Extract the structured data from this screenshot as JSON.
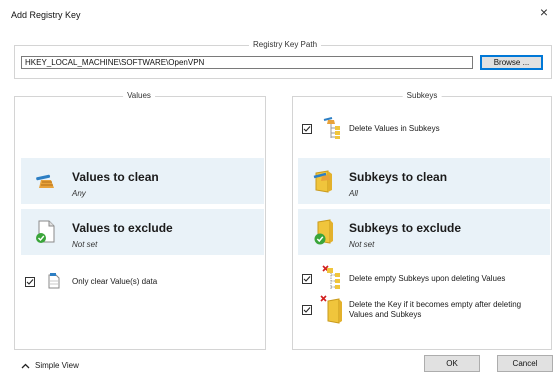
{
  "window": {
    "title": "Add Registry Key",
    "close": "×"
  },
  "path_group": {
    "label": "Registry Key Path",
    "value": "HKEY_LOCAL_MACHINE\\SOFTWARE\\OpenVPN",
    "browse_label": "Browse ..."
  },
  "values_group": {
    "label": "Values",
    "clean": {
      "title": "Values to clean",
      "subtitle": "Any",
      "icon": "broom-icon"
    },
    "exclude": {
      "title": "Values to exclude",
      "subtitle": "Not set",
      "icon": "document-check-icon"
    },
    "only_clear": {
      "label": "Only clear Value(s) data",
      "checked": true
    }
  },
  "subkeys_group": {
    "label": "Subkeys",
    "delete_values": {
      "label": "Delete Values in Subkeys",
      "checked": true
    },
    "clean": {
      "title": "Subkeys to clean",
      "subtitle": "All",
      "icon": "folder-broom-icon"
    },
    "exclude": {
      "title": "Subkeys to exclude",
      "subtitle": "Not set",
      "icon": "folder-check-icon"
    },
    "delete_empty": {
      "label": "Delete empty Subkeys upon deleting Values",
      "checked": true
    },
    "delete_key": {
      "label_line1": "Delete the Key if it becomes empty after deleting",
      "label_line2": "Values and Subkeys",
      "checked": true
    }
  },
  "footer": {
    "simple_view": "Simple View",
    "ok": "OK",
    "cancel": "Cancel"
  },
  "colors": {
    "card_bg": "#e9f2f8",
    "focus_blue": "#0078d7",
    "folder_yellow": "#f0c53c"
  }
}
